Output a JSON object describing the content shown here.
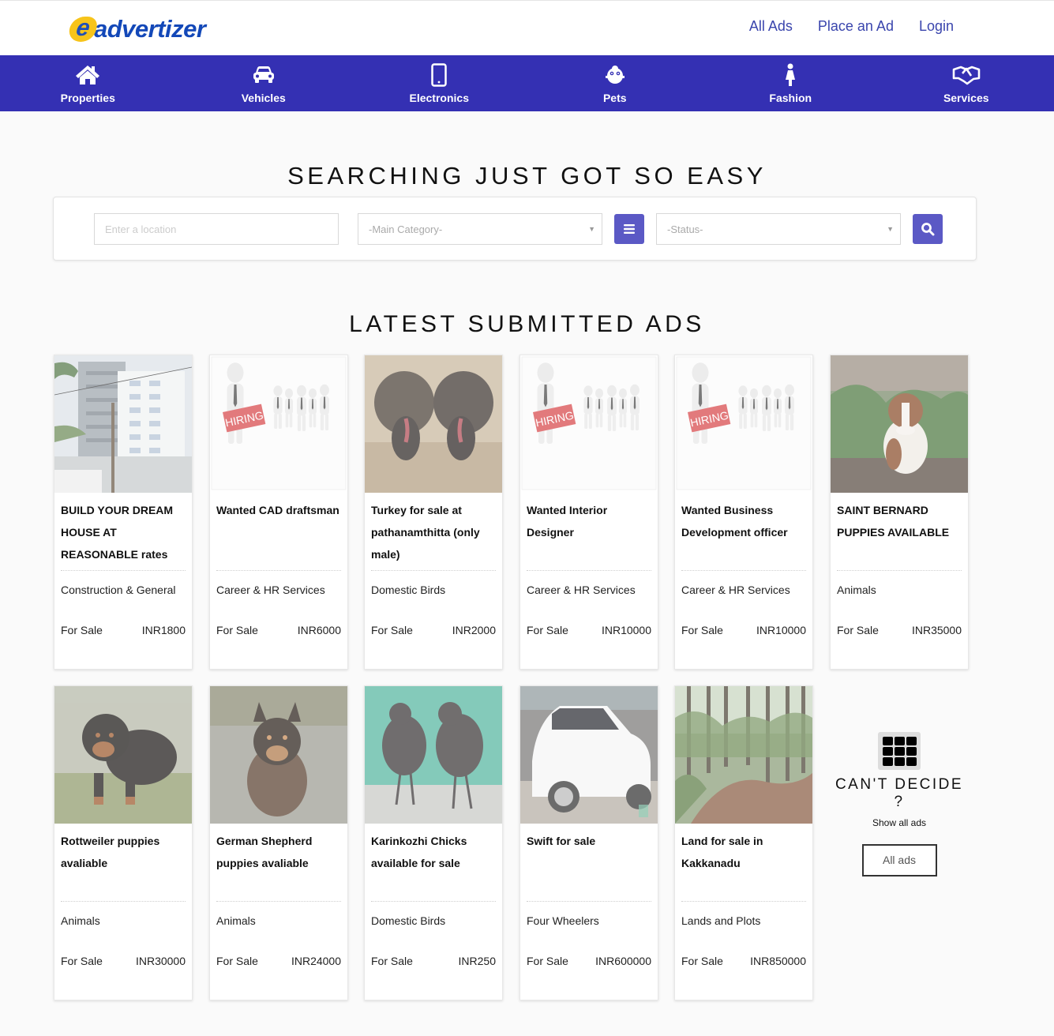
{
  "header": {
    "logo_e": "e",
    "logo_text": "advertizer",
    "links": [
      "All Ads",
      "Place an Ad",
      "Login"
    ]
  },
  "categories": [
    {
      "label": "Properties",
      "icon": "home-icon"
    },
    {
      "label": "Vehicles",
      "icon": "car-icon"
    },
    {
      "label": "Electronics",
      "icon": "mobile-icon"
    },
    {
      "label": "Pets",
      "icon": "pet-icon"
    },
    {
      "label": "Fashion",
      "icon": "female-icon"
    },
    {
      "label": "Services",
      "icon": "handshake-icon"
    }
  ],
  "search": {
    "heading": "SEARCHING JUST GOT SO EASY",
    "location_placeholder": "Enter a location",
    "category_selected": "-Main Category-",
    "status_selected": "-Status-",
    "list_icon": "list-icon",
    "search_icon": "search-icon"
  },
  "latest": {
    "heading": "LATEST SUBMITTED ADS",
    "ads": [
      {
        "title": "BUILD YOUR DREAM HOUSE AT REASONABLE rates",
        "category": "Construction & General",
        "status": "For Sale",
        "price": "INR1800",
        "image": "building"
      },
      {
        "title": "Wanted CAD draftsman",
        "category": "Career & HR Services",
        "status": "For Sale",
        "price": "INR6000",
        "image": "hiring"
      },
      {
        "title": "Turkey for sale at pathanamthitta (only male)",
        "category": "Domestic Birds",
        "status": "For Sale",
        "price": "INR2000",
        "image": "turkey"
      },
      {
        "title": "Wanted Interior Designer",
        "category": "Career & HR Services",
        "status": "For Sale",
        "price": "INR10000",
        "image": "hiring"
      },
      {
        "title": "Wanted Business Development officer",
        "category": "Career & HR Services",
        "status": "For Sale",
        "price": "INR10000",
        "image": "hiring"
      },
      {
        "title": "SAINT BERNARD PUPPIES AVAILABLE",
        "category": "Animals",
        "status": "For Sale",
        "price": "INR35000",
        "image": "saint-bernard"
      },
      {
        "title": "Rottweiler puppies avaliable",
        "category": "Animals",
        "status": "For Sale",
        "price": "INR30000",
        "image": "rottweiler"
      },
      {
        "title": "German Shepherd puppies avaliable",
        "category": "Animals",
        "status": "For Sale",
        "price": "INR24000",
        "image": "german-shepherd"
      },
      {
        "title": "Karinkozhi Chicks available for sale",
        "category": "Domestic Birds",
        "status": "For Sale",
        "price": "INR250",
        "image": "chicks"
      },
      {
        "title": "Swift for sale",
        "category": "Four Wheelers",
        "status": "For Sale",
        "price": "INR600000",
        "image": "car"
      },
      {
        "title": "Land for sale in Kakkanadu",
        "category": "Lands and Plots",
        "status": "For Sale",
        "price": "INR850000",
        "image": "land"
      }
    ]
  },
  "cant_decide": {
    "title": "CAN'T DECIDE ?",
    "subtitle": "Show all ads",
    "button": "All ads",
    "icon": "grid-icon"
  },
  "image_text": {
    "hiring_sign": "HIRING"
  }
}
